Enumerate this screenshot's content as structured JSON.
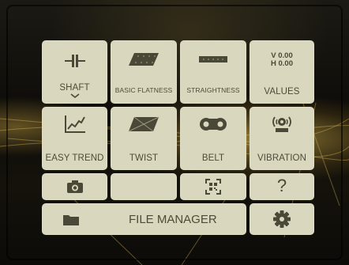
{
  "tiles": {
    "shaft": {
      "label": "SHAFT",
      "icon": "coupling-icon"
    },
    "basic_flatness": {
      "label": "BASIC FLATNESS",
      "icon": "flatness-plane-icon"
    },
    "straightness": {
      "label": "STRAIGHTNESS",
      "icon": "straightness-bar-icon"
    },
    "values": {
      "label": "VALUES",
      "v_text": "V 0.00",
      "h_text": "H 0.00"
    },
    "easy_trend": {
      "label": "EASY TREND",
      "icon": "trend-chart-icon"
    },
    "twist": {
      "label": "TWIST",
      "icon": "twist-plane-icon"
    },
    "belt": {
      "label": "BELT",
      "icon": "belt-pulley-icon"
    },
    "vibration": {
      "label": "VIBRATION",
      "icon": "vibration-sensor-icon"
    },
    "camera": {
      "icon": "camera-icon"
    },
    "blank": {
      "label": ""
    },
    "scan": {
      "icon": "qr-scan-icon"
    },
    "help": {
      "text": "?",
      "icon": "help-icon"
    },
    "file_manager": {
      "label": "FILE MANAGER",
      "icon": "folder-icon"
    },
    "settings": {
      "icon": "gear-icon"
    }
  },
  "colors": {
    "tile": "#d9d7bd",
    "ink": "#4a4836",
    "glow": "#ffd75a"
  }
}
